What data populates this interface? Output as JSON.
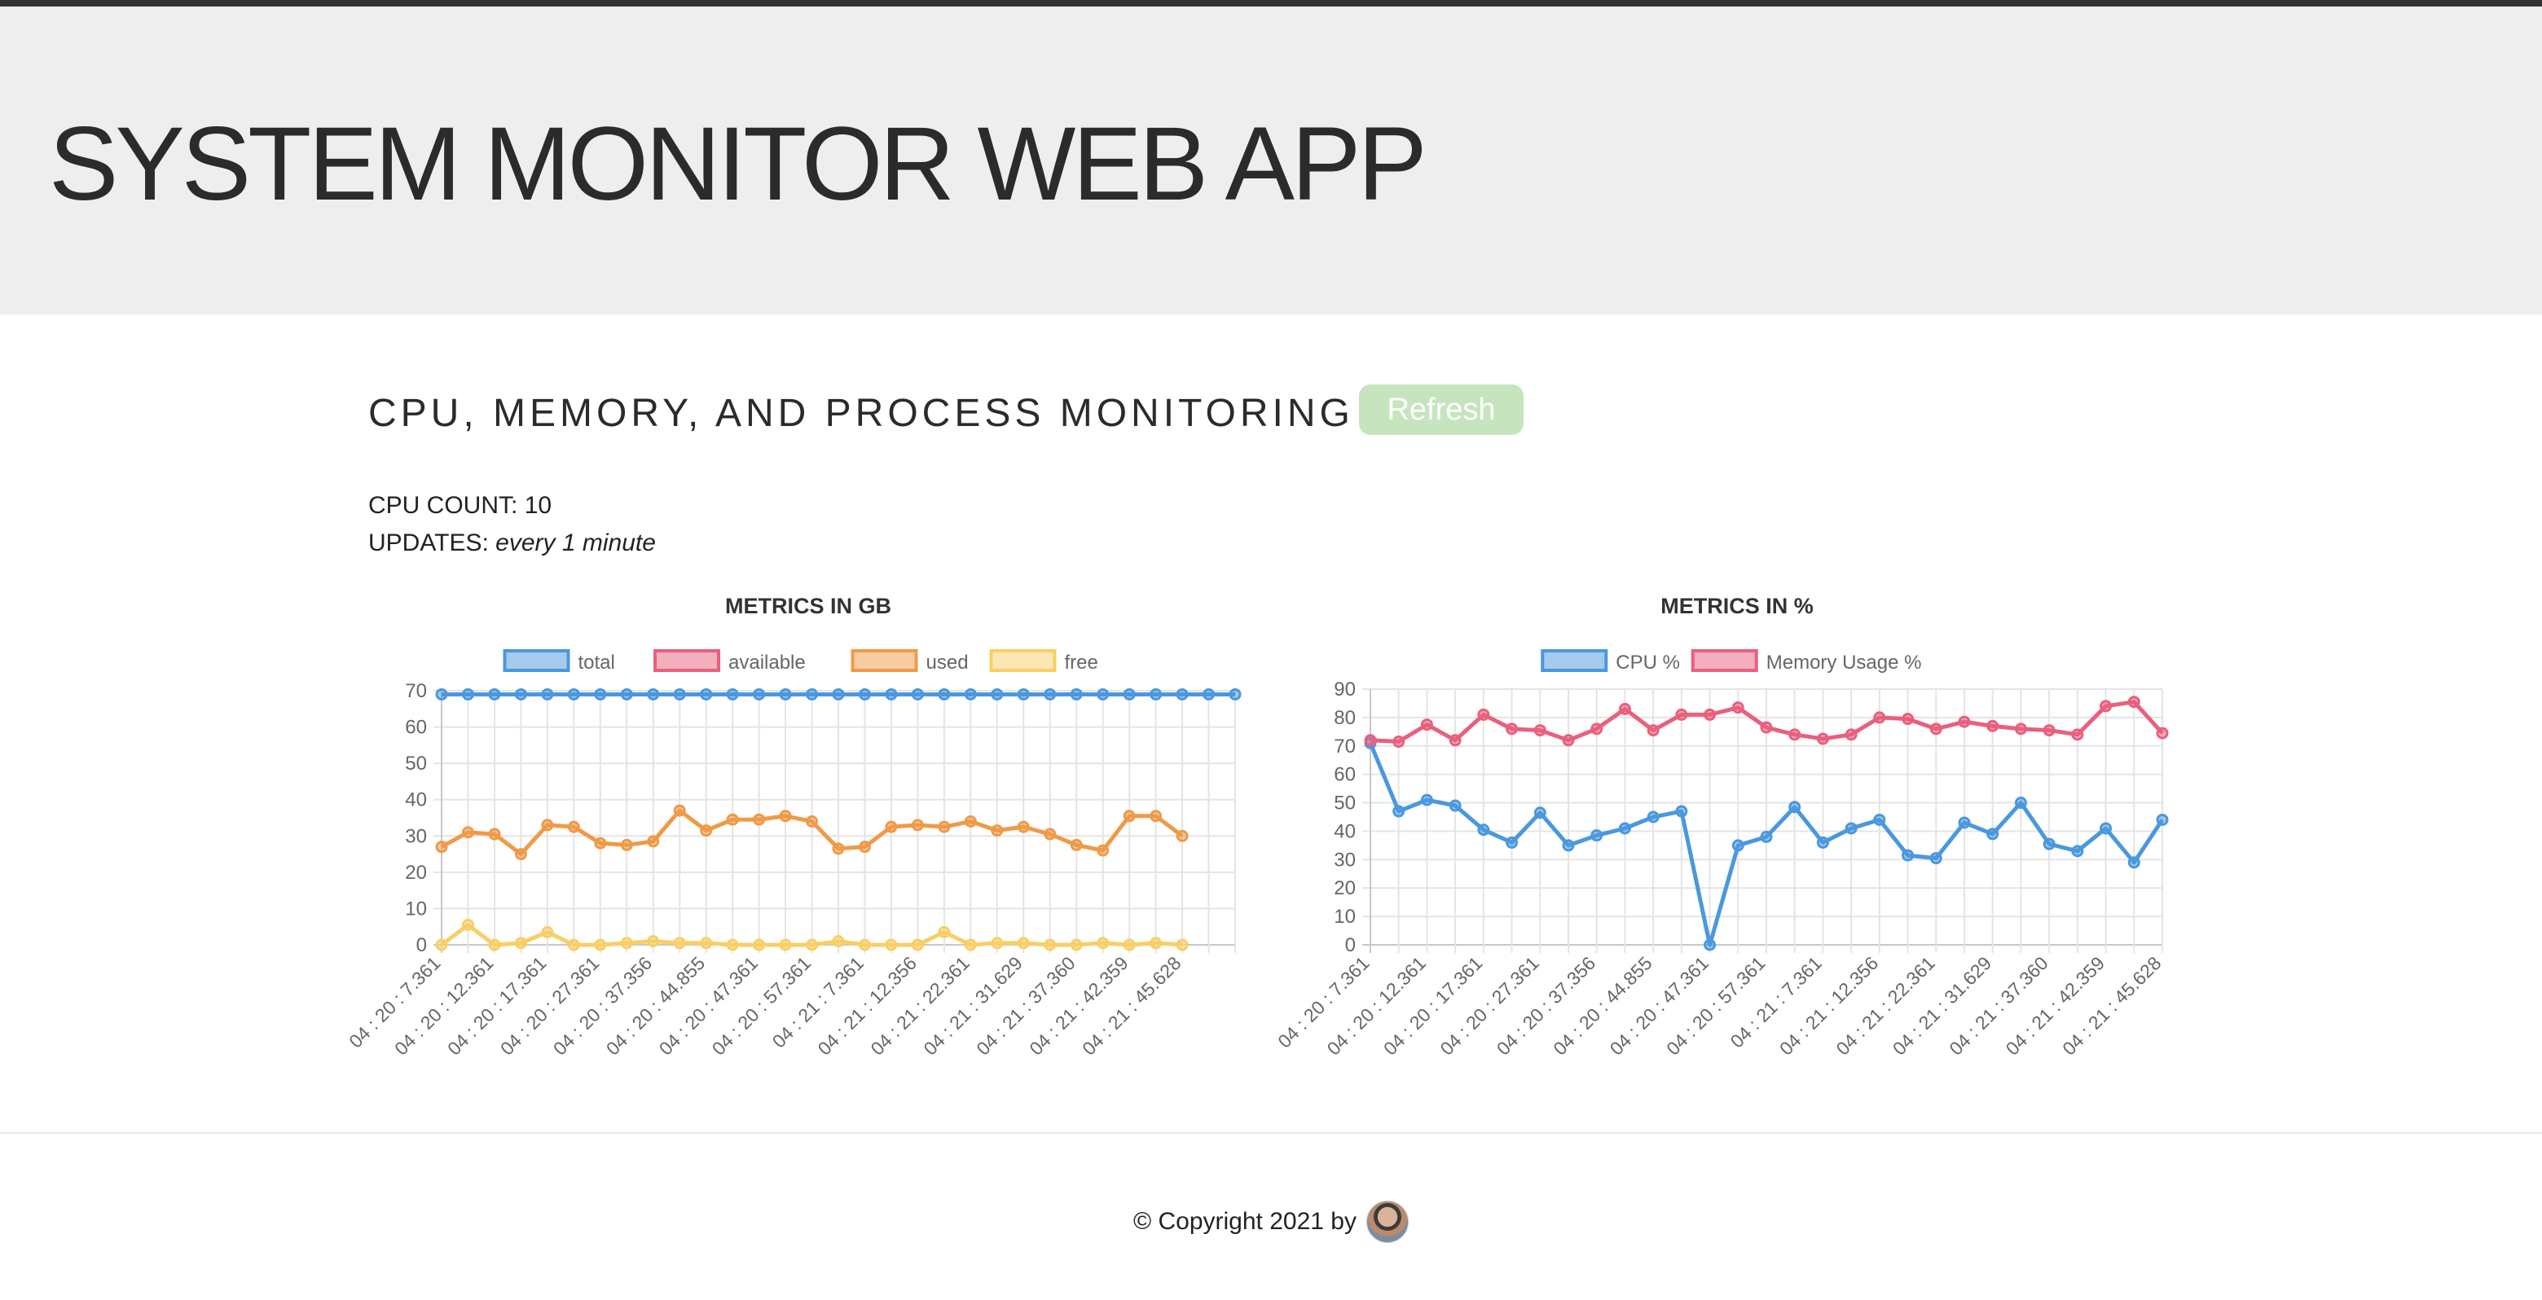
{
  "header": {
    "title": "SYSTEM MONITOR WEB APP"
  },
  "main": {
    "section_title": "CPU, MEMORY, AND PROCESS MONITORING",
    "refresh_label": "Refresh",
    "cpu_count_label": "CPU COUNT:",
    "cpu_count_value": "10",
    "updates_label": "UPDATES:",
    "updates_value": "every 1 minute"
  },
  "footer": {
    "copyright_text": "© Copyright 2021 by"
  },
  "colors": {
    "blue": "#4a98de",
    "red": "#e9607e",
    "orange": "#ef9a48",
    "yellow": "#f8cf66",
    "refresh_button_bg": "#c6e5be"
  },
  "chart_data": [
    {
      "type": "line",
      "title": "METRICS IN GB",
      "ylim": [
        0,
        70
      ],
      "y_ticks": [
        0,
        10,
        20,
        30,
        40,
        50,
        60,
        70
      ],
      "grid": true,
      "legend_position": "top-center",
      "tick_labels": [
        "04 : 20 : 7.361",
        "04 : 20 : 12.361",
        "04 : 20 : 17.361",
        "04 : 20 : 27.361",
        "04 : 20 : 37.356",
        "04 : 20 : 44.855",
        "04 : 20 : 47.361",
        "04 : 20 : 57.361",
        "04 : 21 : 7.361",
        "04 : 21 : 12.356",
        "04 : 21 : 22.361",
        "04 : 21 : 31.629",
        "04 : 21 : 37.360",
        "04 : 21 : 42.359",
        "04 : 21 : 45.628"
      ],
      "series": [
        {
          "name": "total",
          "color": "#4a98de",
          "values": [
            69,
            69,
            69,
            69,
            69,
            69,
            69,
            69,
            69,
            69,
            69,
            69,
            69,
            69,
            69,
            69,
            69,
            69,
            69,
            69,
            69,
            69,
            69,
            69,
            69,
            69,
            69,
            69,
            69,
            69,
            69
          ]
        },
        {
          "name": "available",
          "color": "#e9607e",
          "values": []
        },
        {
          "name": "used",
          "color": "#ef9a48",
          "values": [
            27,
            31,
            30.5,
            25,
            33,
            32.5,
            28,
            27.5,
            28.5,
            37,
            31.5,
            34.5,
            34.5,
            35.5,
            34,
            26.5,
            27,
            32.5,
            33,
            32.5,
            34,
            31.5,
            32.5,
            30.5,
            27.5,
            26,
            35.5,
            35.5,
            30
          ]
        },
        {
          "name": "free",
          "color": "#f8cf66",
          "values": [
            0,
            5.5,
            0,
            0.5,
            3.5,
            0,
            0,
            0.5,
            1,
            0.5,
            0.5,
            0,
            0,
            0,
            0,
            1,
            0,
            0,
            0,
            3.5,
            0,
            0.5,
            0.5,
            0,
            0,
            0.5,
            0,
            0.5,
            0
          ]
        }
      ]
    },
    {
      "type": "line",
      "title": "METRICS IN %",
      "ylim": [
        0,
        90
      ],
      "y_ticks": [
        0,
        10,
        20,
        30,
        40,
        50,
        60,
        70,
        80,
        90
      ],
      "grid": true,
      "legend_position": "top-center",
      "tick_labels": [
        "04 : 20 : 7.361",
        "04 : 20 : 12.361",
        "04 : 20 : 17.361",
        "04 : 20 : 27.361",
        "04 : 20 : 37.356",
        "04 : 20 : 44.855",
        "04 : 20 : 47.361",
        "04 : 20 : 57.361",
        "04 : 21 : 7.361",
        "04 : 21 : 12.356",
        "04 : 21 : 22.361",
        "04 : 21 : 31.629",
        "04 : 21 : 37.360",
        "04 : 21 : 42.359",
        "04 : 21 : 45.628"
      ],
      "series": [
        {
          "name": "CPU %",
          "color": "#4a98de",
          "values": [
            71,
            47,
            51,
            49,
            40.5,
            36,
            46.5,
            35,
            38.5,
            41,
            45,
            47,
            0,
            35,
            38,
            48.5,
            36,
            41,
            44,
            31.5,
            30.5,
            43,
            39,
            50,
            35.5,
            33,
            41,
            29,
            44
          ]
        },
        {
          "name": "Memory Usage %",
          "color": "#e9607e",
          "values": [
            72,
            71.5,
            77.5,
            72,
            81,
            76,
            75.5,
            72,
            76,
            83,
            75.5,
            81,
            81,
            83.5,
            76.5,
            74,
            72.5,
            74,
            80,
            79.5,
            76,
            78.5,
            77,
            76,
            75.5,
            74,
            84,
            85.5,
            74.5
          ]
        }
      ]
    }
  ]
}
